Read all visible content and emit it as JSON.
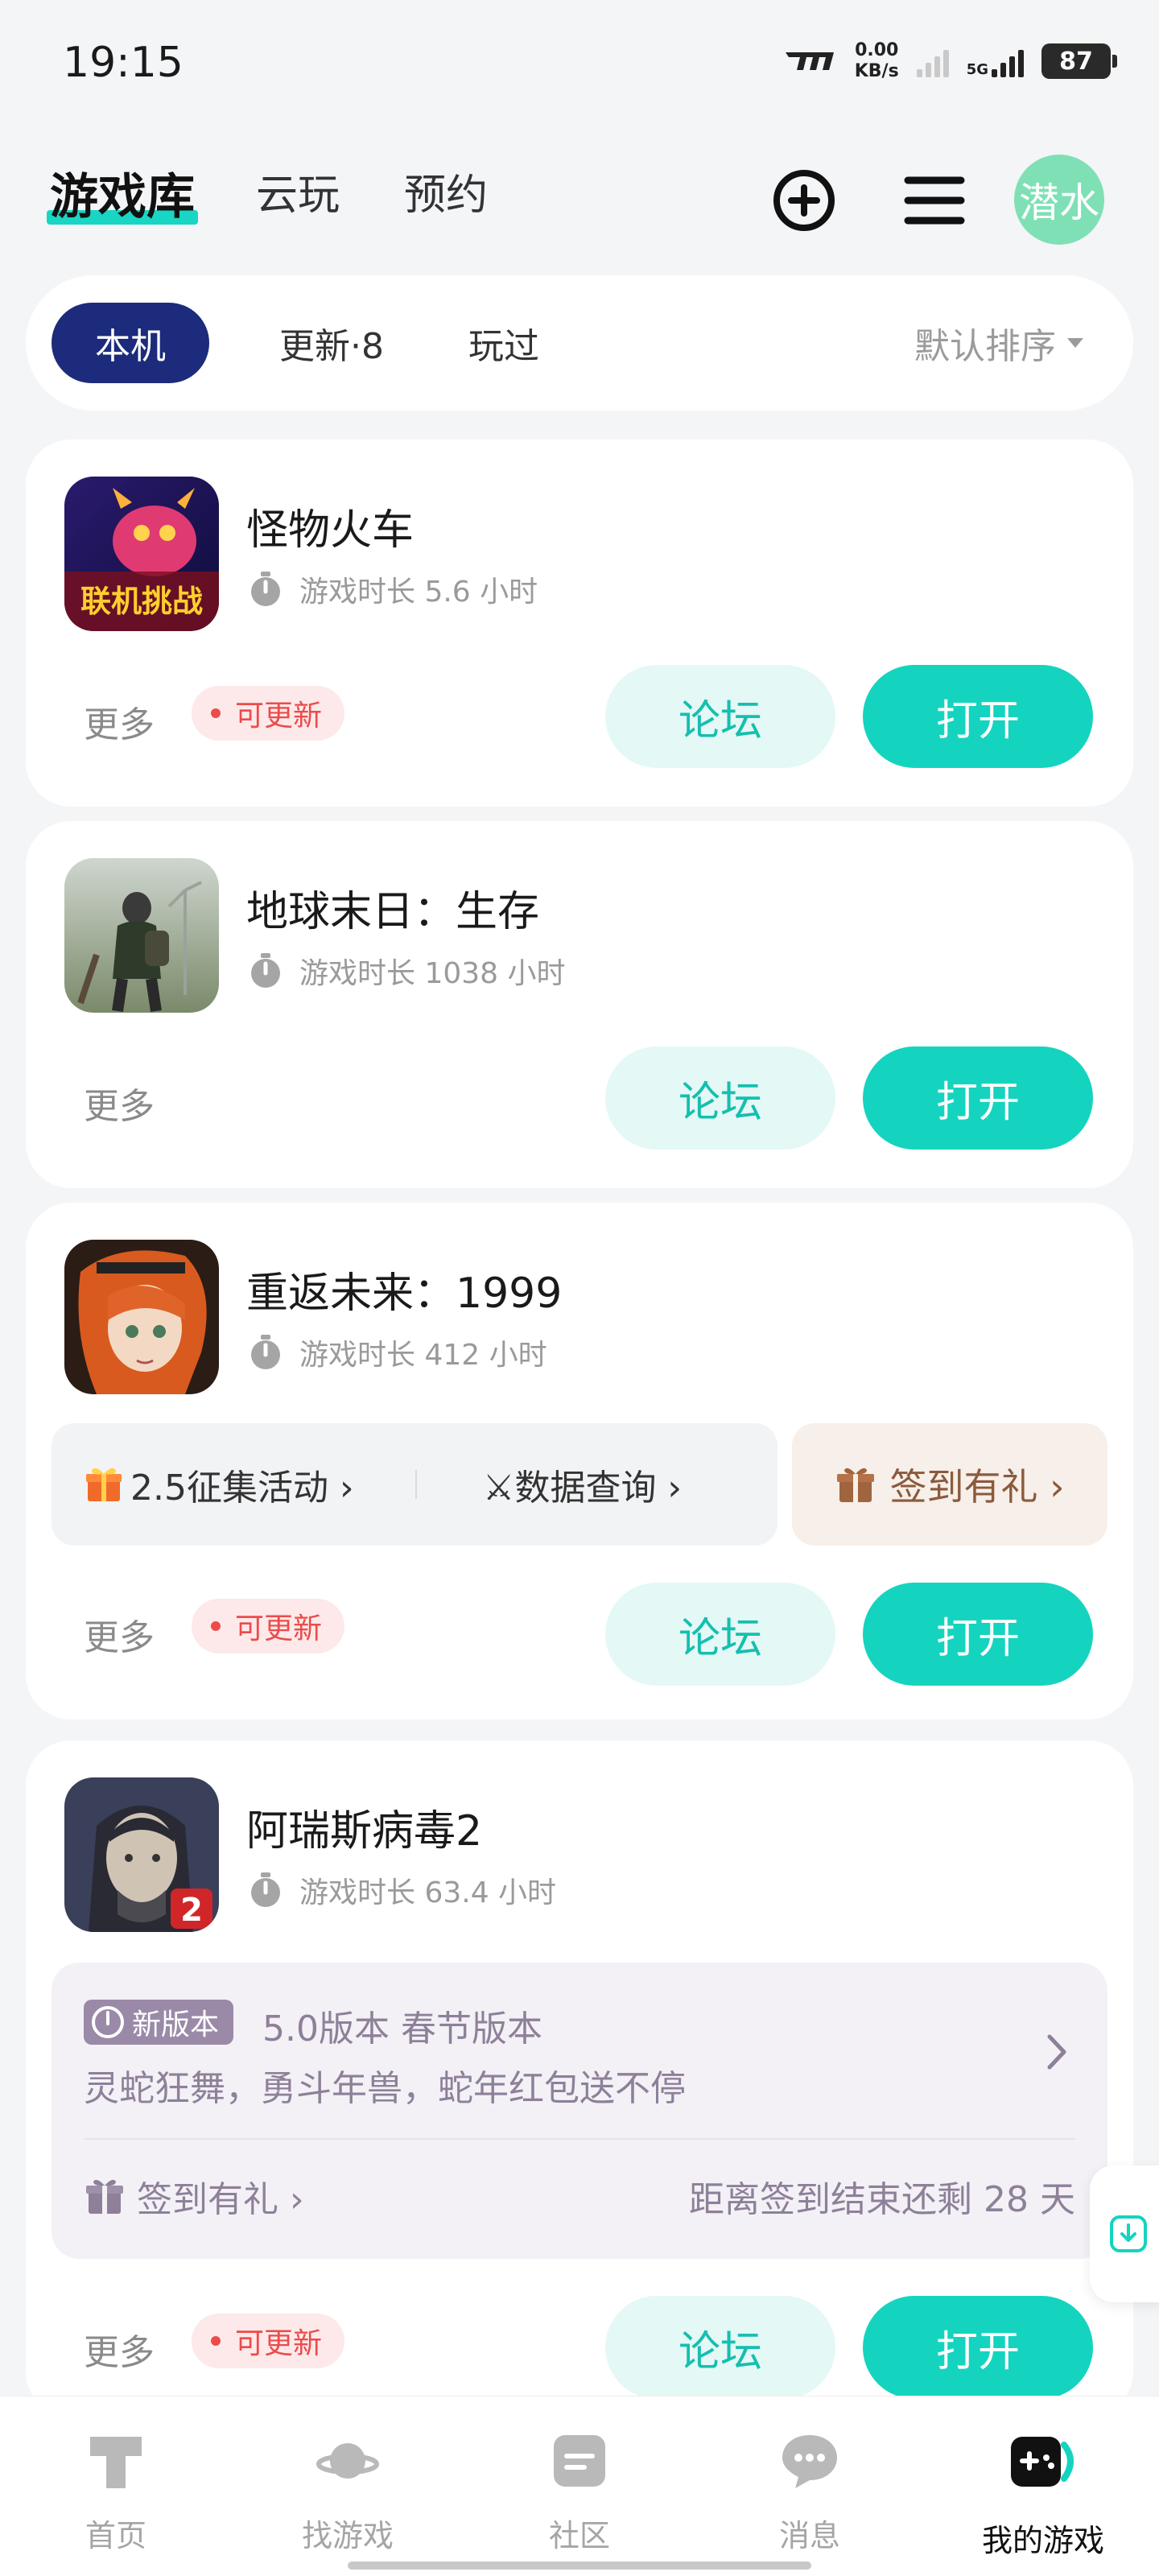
{
  "status_bar": {
    "time": "19:15",
    "net_speed_value": "0.00",
    "net_speed_unit": "KB/s",
    "network_type": "5G",
    "battery": "87"
  },
  "top_nav": {
    "tabs": [
      "游戏库",
      "云玩",
      "预约"
    ],
    "active_tab": "游戏库",
    "avatar_text": "潜水"
  },
  "filter": {
    "chips": [
      "本机",
      "更新·8",
      "玩过"
    ],
    "active_chip": "本机",
    "sort_label": "默认排序"
  },
  "common": {
    "more_label": "更多",
    "update_label": "可更新",
    "forum_label": "论坛",
    "open_label": "打开"
  },
  "games": [
    {
      "name": "怪物火车",
      "playtime": "游戏时长 5.6 小时",
      "updatable": true,
      "icon": "monster-train-icon"
    },
    {
      "name": "地球末日：生存",
      "playtime": "游戏时长 1038 小时",
      "updatable": false,
      "icon": "last-day-on-earth-icon"
    },
    {
      "name": "重返未来：1999",
      "playtime": "游戏时长 412 小时",
      "updatable": true,
      "icon": "reverse-1999-icon",
      "activities": [
        "2.5征集活动 ›",
        "⚔数据查询 ›"
      ],
      "sign_in": "签到有礼 ›"
    },
    {
      "name": "阿瑞斯病毒2",
      "playtime": "游戏时长 63.4 小时",
      "updatable": true,
      "icon": "ares-virus-2-icon",
      "news": {
        "tag": "新版本",
        "title": "5.0版本 春节版本",
        "desc": "灵蛇狂舞，勇斗年兽，蛇年红包送不停",
        "sign_in": "签到有礼 ›",
        "remain": "距离签到结束还剩 28 天"
      }
    }
  ],
  "bottom_nav": {
    "items": [
      "首页",
      "找游戏",
      "社区",
      "消息",
      "我的游戏"
    ],
    "active": "我的游戏"
  },
  "colors": {
    "accent": "#14d4bf",
    "active_chip": "#1c2b7b",
    "update_red": "#ec4b4b"
  }
}
